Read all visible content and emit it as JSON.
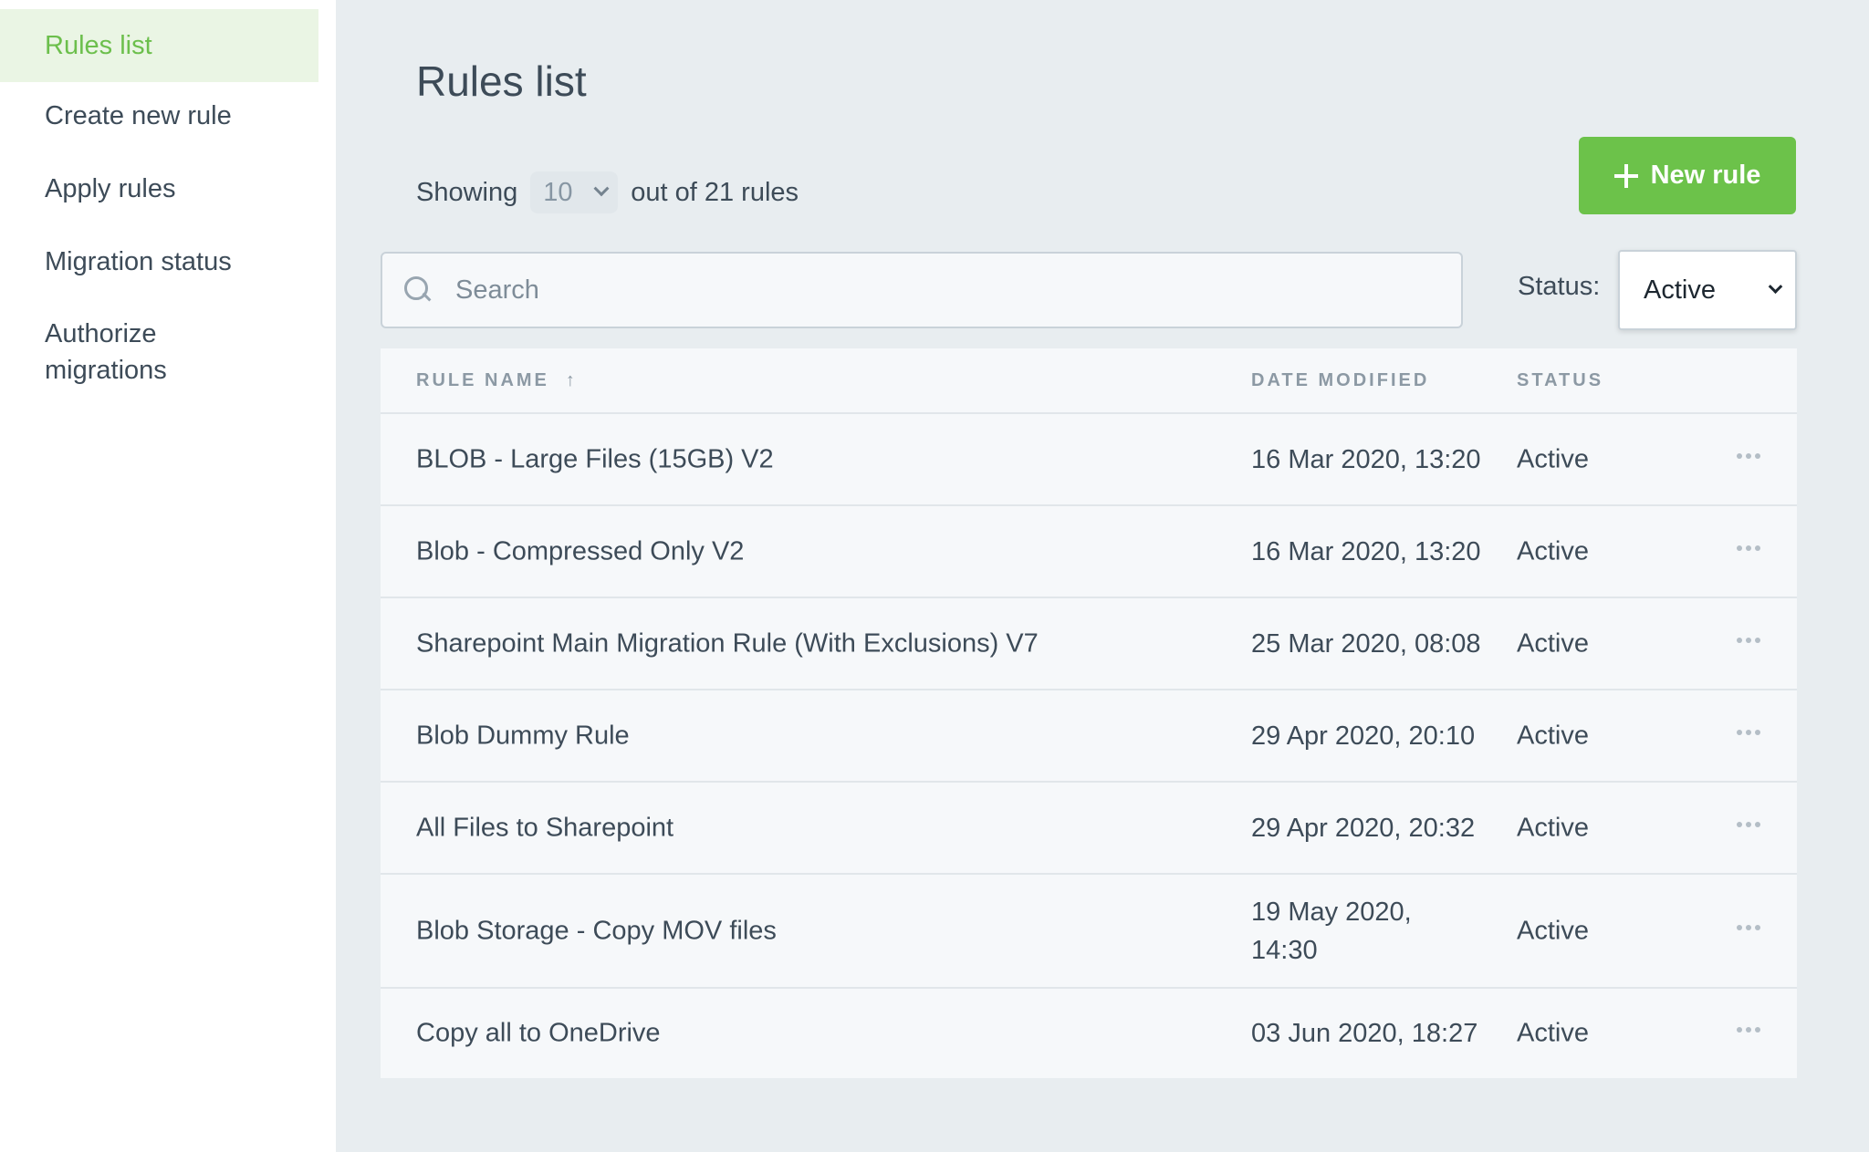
{
  "sidebar": {
    "items": [
      {
        "label": "Rules list",
        "active": true
      },
      {
        "label": "Create new rule",
        "active": false
      },
      {
        "label": "Apply rules",
        "active": false
      },
      {
        "label": "Migration status",
        "active": false
      },
      {
        "label": "Authorize migrations",
        "active": false
      }
    ]
  },
  "main": {
    "title": "Rules list",
    "showing_prefix": "Showing",
    "page_size": "10",
    "showing_suffix": "out of 21 rules",
    "new_rule_label": "New rule",
    "search_placeholder": "Search",
    "status_filter_label": "Status:",
    "status_filter_value": "Active"
  },
  "table": {
    "columns": [
      "RULE NAME",
      "DATE MODIFIED",
      "STATUS"
    ],
    "sort_indicator": "↑",
    "rows": [
      {
        "name": "BLOB - Large Files (15GB) V2",
        "date": "16 Mar 2020, 13:20",
        "status": "Active"
      },
      {
        "name": "Blob - Compressed Only V2",
        "date": "16 Mar 2020, 13:20",
        "status": "Active"
      },
      {
        "name": "Sharepoint Main Migration Rule (With Exclusions) V7",
        "date": "25 Mar 2020, 08:08",
        "status": "Active"
      },
      {
        "name": "Blob Dummy Rule",
        "date": "29 Apr 2020, 20:10",
        "status": "Active"
      },
      {
        "name": "All Files to Sharepoint",
        "date": "29 Apr 2020, 20:32",
        "status": "Active"
      },
      {
        "name": "Blob Storage - Copy MOV files",
        "date": "19 May 2020, 14:30",
        "status": "Active"
      },
      {
        "name": "Copy all to OneDrive",
        "date": "03 Jun 2020, 18:27",
        "status": "Active"
      }
    ]
  },
  "colors": {
    "accent": "#6cc24a",
    "active_nav_bg": "#eaf5e4",
    "background": "#e8edf0"
  }
}
